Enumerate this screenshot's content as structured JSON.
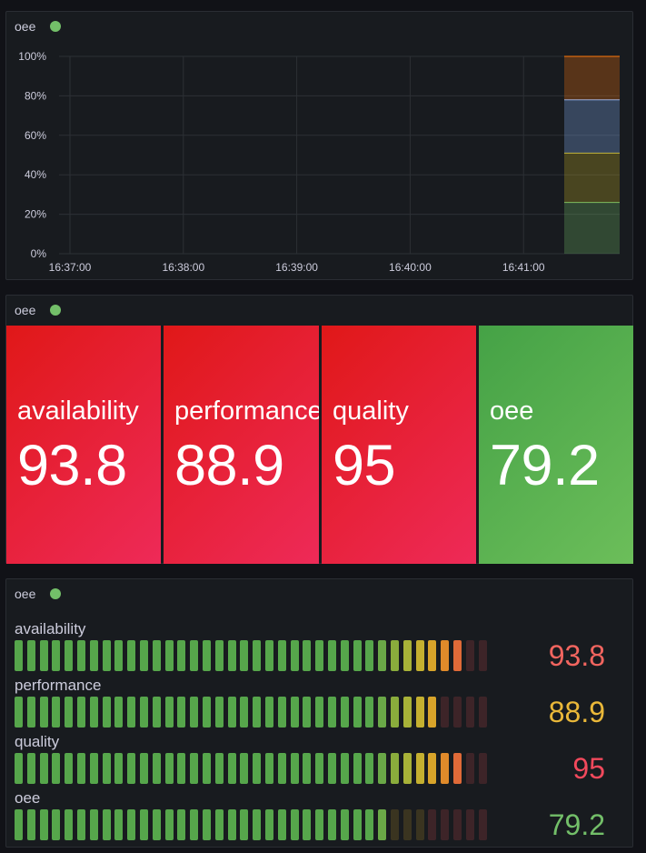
{
  "panels": {
    "timeseries": {
      "title": "oee",
      "status_color": "#73bf69"
    },
    "stat": {
      "title": "oee",
      "items": [
        {
          "label": "availability",
          "value": "93.8",
          "color": "red"
        },
        {
          "label": "performance",
          "value": "88.9",
          "color": "red"
        },
        {
          "label": "quality",
          "value": "95",
          "color": "red"
        },
        {
          "label": "oee",
          "value": "79.2",
          "color": "green"
        }
      ]
    },
    "bargauge": {
      "title": "oee",
      "rows": [
        {
          "label": "availability",
          "value": "93.8",
          "value_color": "#f2655f",
          "lit_cells": 36
        },
        {
          "label": "performance",
          "value": "88.9",
          "value_color": "#eab839",
          "lit_cells": 34
        },
        {
          "label": "quality",
          "value": "95",
          "value_color": "#f2495c",
          "lit_cells": 36
        },
        {
          "label": "oee",
          "value": "79.2",
          "value_color": "#73bf69",
          "lit_cells": 30
        }
      ],
      "total_cells": 38
    }
  },
  "chart_data": {
    "type": "area",
    "x_ticks": [
      "16:37:00",
      "16:38:00",
      "16:39:00",
      "16:40:00",
      "16:41:00"
    ],
    "y_ticks": [
      "0%",
      "20%",
      "40%",
      "60%",
      "80%",
      "100%"
    ],
    "ylim": [
      0,
      100
    ],
    "stacking": "percent",
    "grid": true,
    "series": [
      {
        "color": "#73bf69",
        "values": [
          26
        ]
      },
      {
        "color": "#c9b524",
        "values": [
          25
        ]
      },
      {
        "color": "#8ab8ff",
        "values": [
          27
        ]
      },
      {
        "color": "#ff780a",
        "values": [
          22
        ]
      }
    ]
  }
}
